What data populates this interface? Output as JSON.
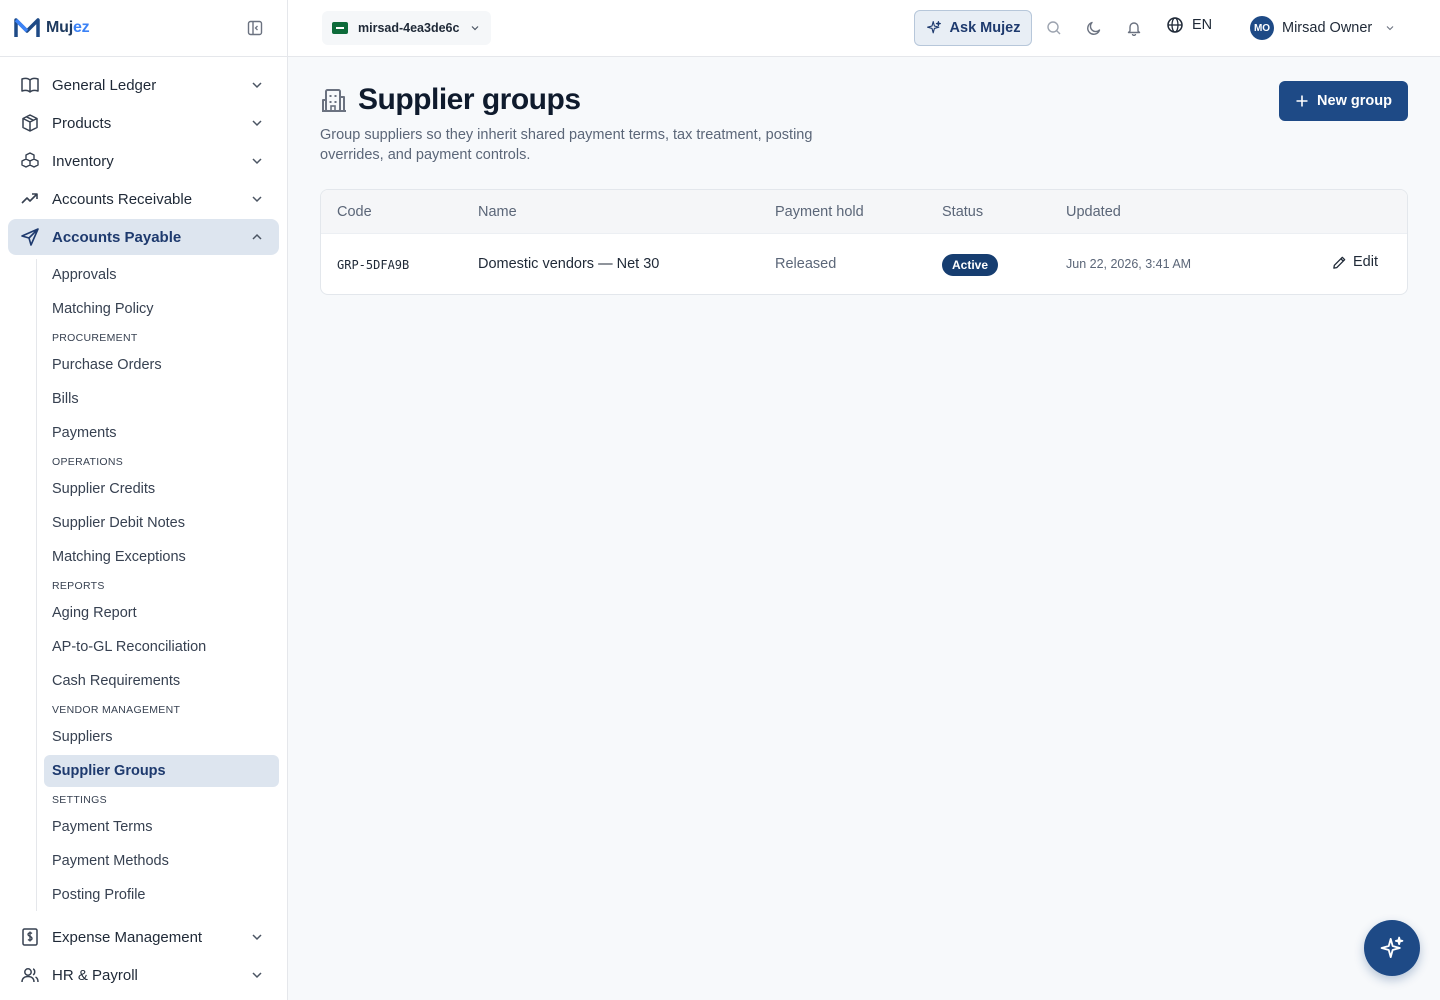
{
  "brand": {
    "name_main": "Muj",
    "name_accent": "ez",
    "color": "#1e4a86"
  },
  "topbar": {
    "tenant": "mirsad-4ea3de6c",
    "ask_label": "Ask Mujez",
    "language": "EN",
    "user_initials": "MO",
    "user_name": "Mirsad Owner"
  },
  "sidebar": {
    "items_top": [
      {
        "label": "General Ledger",
        "icon": "book-icon"
      },
      {
        "label": "Products",
        "icon": "box-icon"
      },
      {
        "label": "Inventory",
        "icon": "boxes-icon"
      },
      {
        "label": "Accounts Receivable",
        "icon": "trending-up-icon"
      }
    ],
    "active_section": {
      "label": "Accounts Payable",
      "icon": "send-icon"
    },
    "sub": {
      "approvals": "Approvals",
      "matching_policy": "Matching Policy",
      "sec_procurement": "PROCUREMENT",
      "purchase_orders": "Purchase Orders",
      "bills": "Bills",
      "payments": "Payments",
      "sec_operations": "OPERATIONS",
      "supplier_credits": "Supplier Credits",
      "supplier_debit_notes": "Supplier Debit Notes",
      "matching_exceptions": "Matching Exceptions",
      "sec_reports": "REPORTS",
      "aging_report": "Aging Report",
      "ap_gl": "AP-to-GL Reconciliation",
      "cash_req": "Cash Requirements",
      "sec_vendor": "VENDOR MANAGEMENT",
      "suppliers": "Suppliers",
      "supplier_groups": "Supplier Groups",
      "sec_settings": "SETTINGS",
      "payment_terms": "Payment Terms",
      "payment_methods": "Payment Methods",
      "posting_profile": "Posting Profile"
    },
    "items_bottom": [
      {
        "label": "Expense Management",
        "icon": "receipt-icon"
      },
      {
        "label": "HR & Payroll",
        "icon": "users-icon"
      }
    ]
  },
  "page": {
    "title": "Supplier groups",
    "subtitle": "Group suppliers so they inherit shared payment terms, tax treatment, posting overrides, and payment controls.",
    "new_button": "New group"
  },
  "table": {
    "columns": [
      "Code",
      "Name",
      "Payment hold",
      "Status",
      "Updated"
    ],
    "rows": [
      {
        "code": "GRP-5DFA9B",
        "name": "Domestic vendors — Net 30",
        "payment_hold": "Released",
        "status": "Active",
        "updated": "Jun 22, 2026, 3:41 AM",
        "action": "Edit"
      }
    ]
  }
}
